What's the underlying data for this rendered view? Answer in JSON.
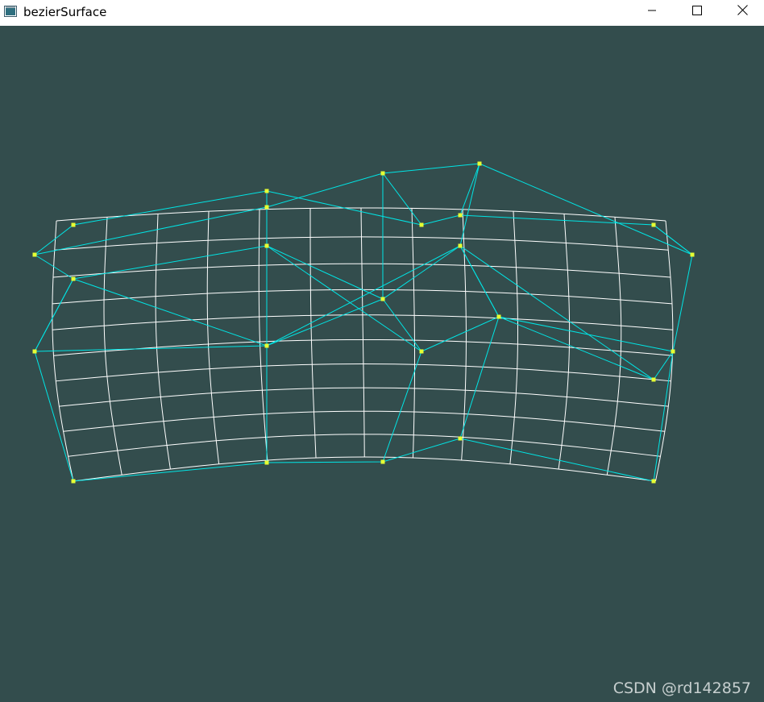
{
  "window": {
    "title": "bezierSurface",
    "icon": "opengl-window-icon",
    "controls": [
      "minimize-icon",
      "maximize-icon",
      "close-icon"
    ]
  },
  "canvas": {
    "background": "#334d4d",
    "mesh_color": "#ffffff",
    "control_net_color": "#00e5e5",
    "control_point_color": "#e6ff33"
  },
  "watermark": {
    "text": "CSDN @rd142857"
  }
}
